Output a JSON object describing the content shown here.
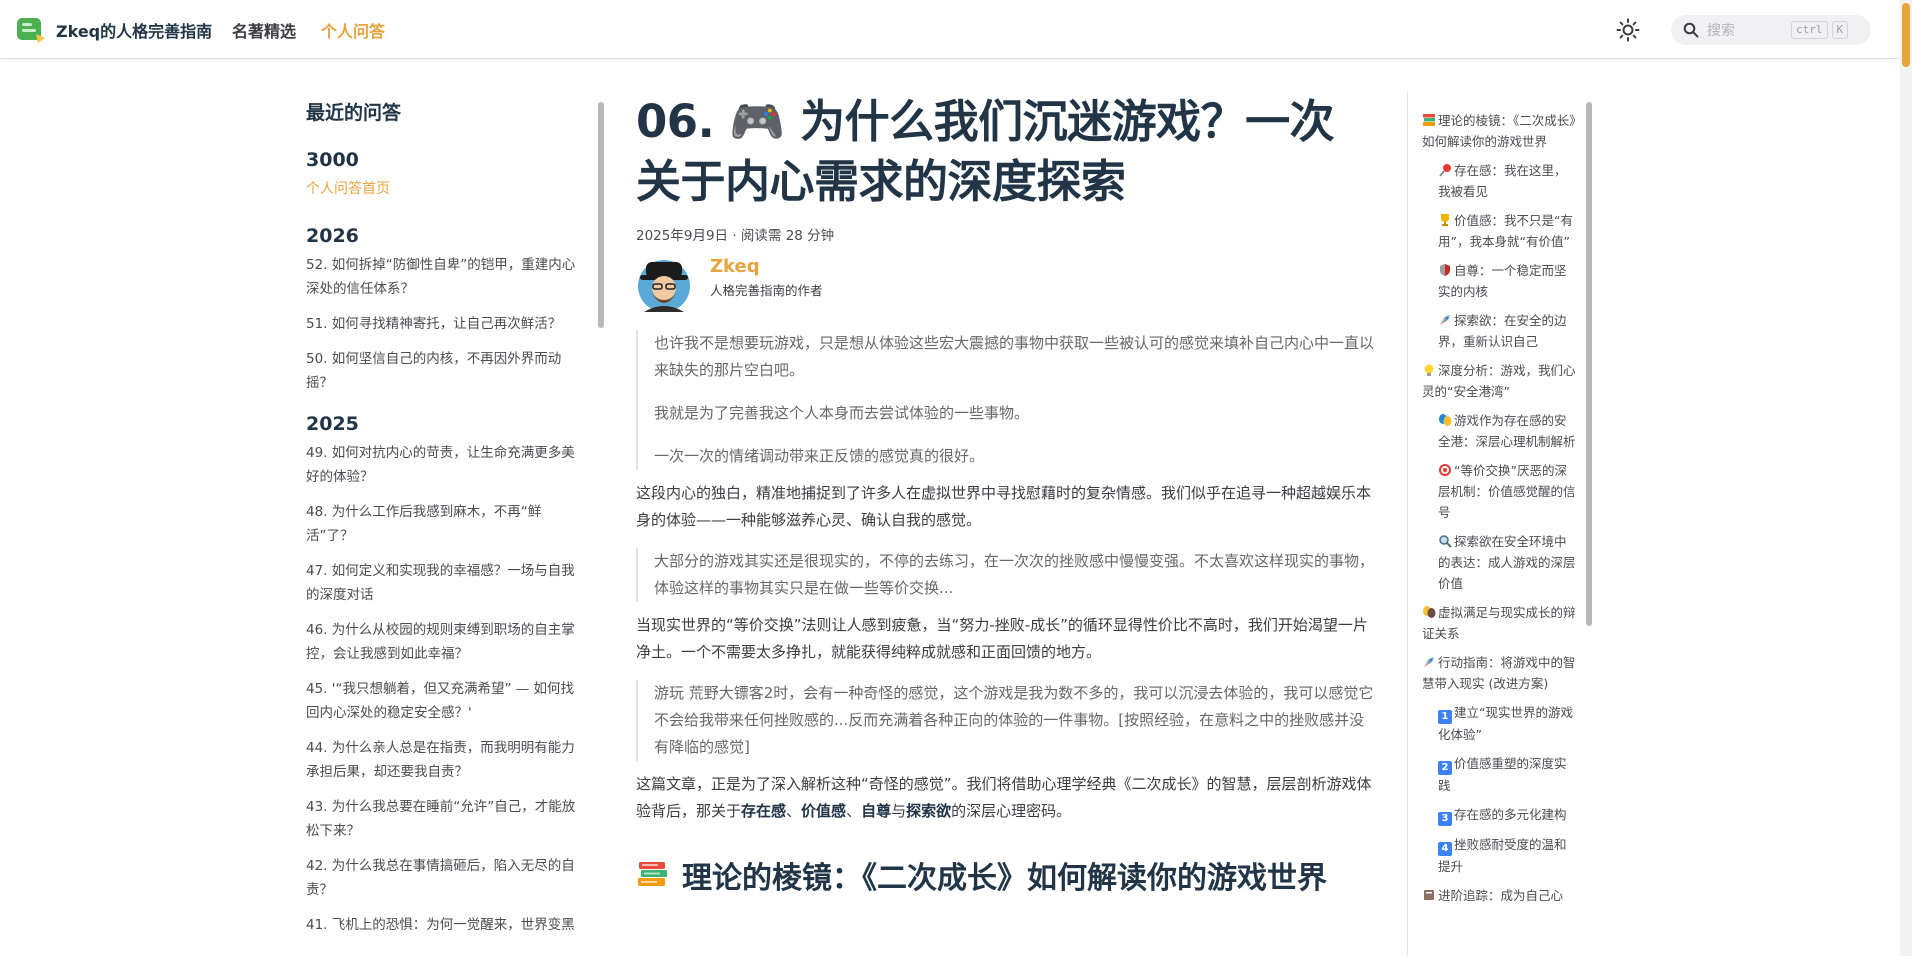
{
  "nav": {
    "site_title": "Zkeq的人格完善指南",
    "links": [
      "名著精选",
      "个人问答"
    ],
    "search_placeholder": "搜索",
    "kbd_ctrl": "ctrl",
    "kbd_k": "K"
  },
  "sidebar": {
    "heading": "最近的问答",
    "group_3000": "3000",
    "home_link": "个人问答首页",
    "year_2026": "2026",
    "items_2026": [
      "52. 如何拆掉“防御性自卑”的铠甲，重建内心深处的信任体系？",
      "51. 如何寻找精神寄托，让自己再次鲜活？",
      "50. 如何坚信自己的内核，不再因外界而动摇？"
    ],
    "year_2025": "2025",
    "items_2025": [
      "49. 如何对抗内心的苛责，让生命充满更多美好的体验？",
      "48. 为什么工作后我感到麻木，不再“鲜活”了？",
      "47. 如何定义和实现我的幸福感？一场与自我的深度对话",
      "46. 为什么从校园的规则束缚到职场的自主掌控，会让我感到如此幸福？",
      "45. '“我只想躺着，但又充满希望” — 如何找回内心深处的稳定安全感？'",
      "44. 为什么亲人总是在指责，而我明明有能力承担后果，却还要我自责？",
      "43. 为什么我总要在睡前“允许”自己，才能放松下来？",
      "42. 为什么我总在事情搞砸后，陷入无尽的自责？",
      "41. 飞机上的恐惧：为何一觉醒来，世界变黑"
    ]
  },
  "article": {
    "title": "06. 🎮 为什么我们沉迷游戏？一次关于内心需求的深度探索",
    "meta": "2025年9月9日 · 阅读需 28 分钟",
    "author_name": "Zkeq",
    "author_role": "人格完善指南的作者",
    "quote1": [
      "也许我不是想要玩游戏，只是想从体验这些宏大震撼的事物中获取一些被认可的感觉来填补自己内心中一直以来缺失的那片空白吧。",
      "我就是为了完善我这个人本身而去尝试体验的一些事物。",
      "一次一次的情绪调动带来正反馈的感觉真的很好。"
    ],
    "para1": "这段内心的独白，精准地捕捉到了许多人在虚拟世界中寻找慰藉时的复杂情感。我们似乎在追寻一种超越娱乐本身的体验——一种能够滋养心灵、确认自我的感觉。",
    "quote2": "大部分的游戏其实还是很现实的，不停的去练习，在一次次的挫败感中慢慢变强。不太喜欢这样现实的事物，体验这样的事物其实只是在做一些等价交换...",
    "para2": "当现实世界的“等价交换”法则让人感到疲惫，当“努力-挫败-成长”的循环显得性价比不高时，我们开始渴望一片净土。一个不需要太多挣扎，就能获得纯粹成就感和正面回馈的地方。",
    "quote3": "游玩 荒野大镖客2时，会有一种奇怪的感觉，这个游戏是我为数不多的，我可以沉浸去体验的，我可以感觉它不会给我带来任何挫败感的...反而充满着各种正向的体验的一件事物。[按照经验，在意料之中的挫败感并没有降临的感觉]",
    "para3_a": "这篇文章，正是为了深入解析这种“奇怪的感觉”。我们将借助心理学经典《二次成长》的智慧，层层剖析游戏体验背后，那关于",
    "para3_b1": "存在感",
    "para3_sep1": "、",
    "para3_b2": "价值感",
    "para3_sep2": "、",
    "para3_b3": "自尊",
    "para3_sep3": "与",
    "para3_b4": "探索欲",
    "para3_c": "的深层心理密码。",
    "h2": "理论的棱镜：《二次成长》如何解读你的游戏世界"
  },
  "toc": [
    {
      "icon": "books-icon",
      "text": "理论的棱镜：《二次成长》如何解读你的游戏世界",
      "level": 1
    },
    {
      "icon": "pushpin-icon",
      "text": "存在感：我在这里，我被看见",
      "level": 2
    },
    {
      "icon": "trophy-icon",
      "text": "价值感：我不只是“有用”，我本身就“有价值”",
      "level": 2
    },
    {
      "icon": "shield-icon",
      "text": "自尊：一个稳定而坚实的内核",
      "level": 2
    },
    {
      "icon": "rocket-icon",
      "text": "探索欲：在安全的边界，重新认识自己",
      "level": 2
    },
    {
      "icon": "bulb-icon",
      "text": "深度分析：游戏，我们心灵的“安全港湾”",
      "level": 1
    },
    {
      "icon": "masks-icon",
      "text": "游戏作为存在感的安全港：深层心理机制解析",
      "level": 2
    },
    {
      "icon": "target-icon",
      "text": "“等价交换”厌恶的深层机制：价值感觉醒的信号",
      "level": 2
    },
    {
      "icon": "magnifier-icon",
      "text": "探索欲在安全环境中的表达：成人游戏的深层价值",
      "level": 2
    },
    {
      "icon": "masks-icon",
      "text": "虚拟满足与现实成长的辩证关系",
      "level": 1
    },
    {
      "icon": "rocket-icon",
      "text": "行动指南：将游戏中的智慧带入现实 (改进方案)",
      "level": 1
    },
    {
      "icon": "keycap-1-icon",
      "badge": "1",
      "text": "建立“现实世界的游戏化体验”",
      "level": 2
    },
    {
      "icon": "keycap-2-icon",
      "badge": "2",
      "text": "价值感重塑的深度实践",
      "level": 2
    },
    {
      "icon": "keycap-3-icon",
      "badge": "3",
      "text": "存在感的多元化建构",
      "level": 2
    },
    {
      "icon": "keycap-4-icon",
      "badge": "4",
      "text": "挫败感耐受度的温和提升",
      "level": 2
    },
    {
      "icon": "book-icon",
      "text": "进阶追踪：成为自己心",
      "level": 1
    }
  ],
  "colors": {
    "accent": "#e7a33e",
    "heading": "#213547",
    "text": "#3c3c43"
  }
}
